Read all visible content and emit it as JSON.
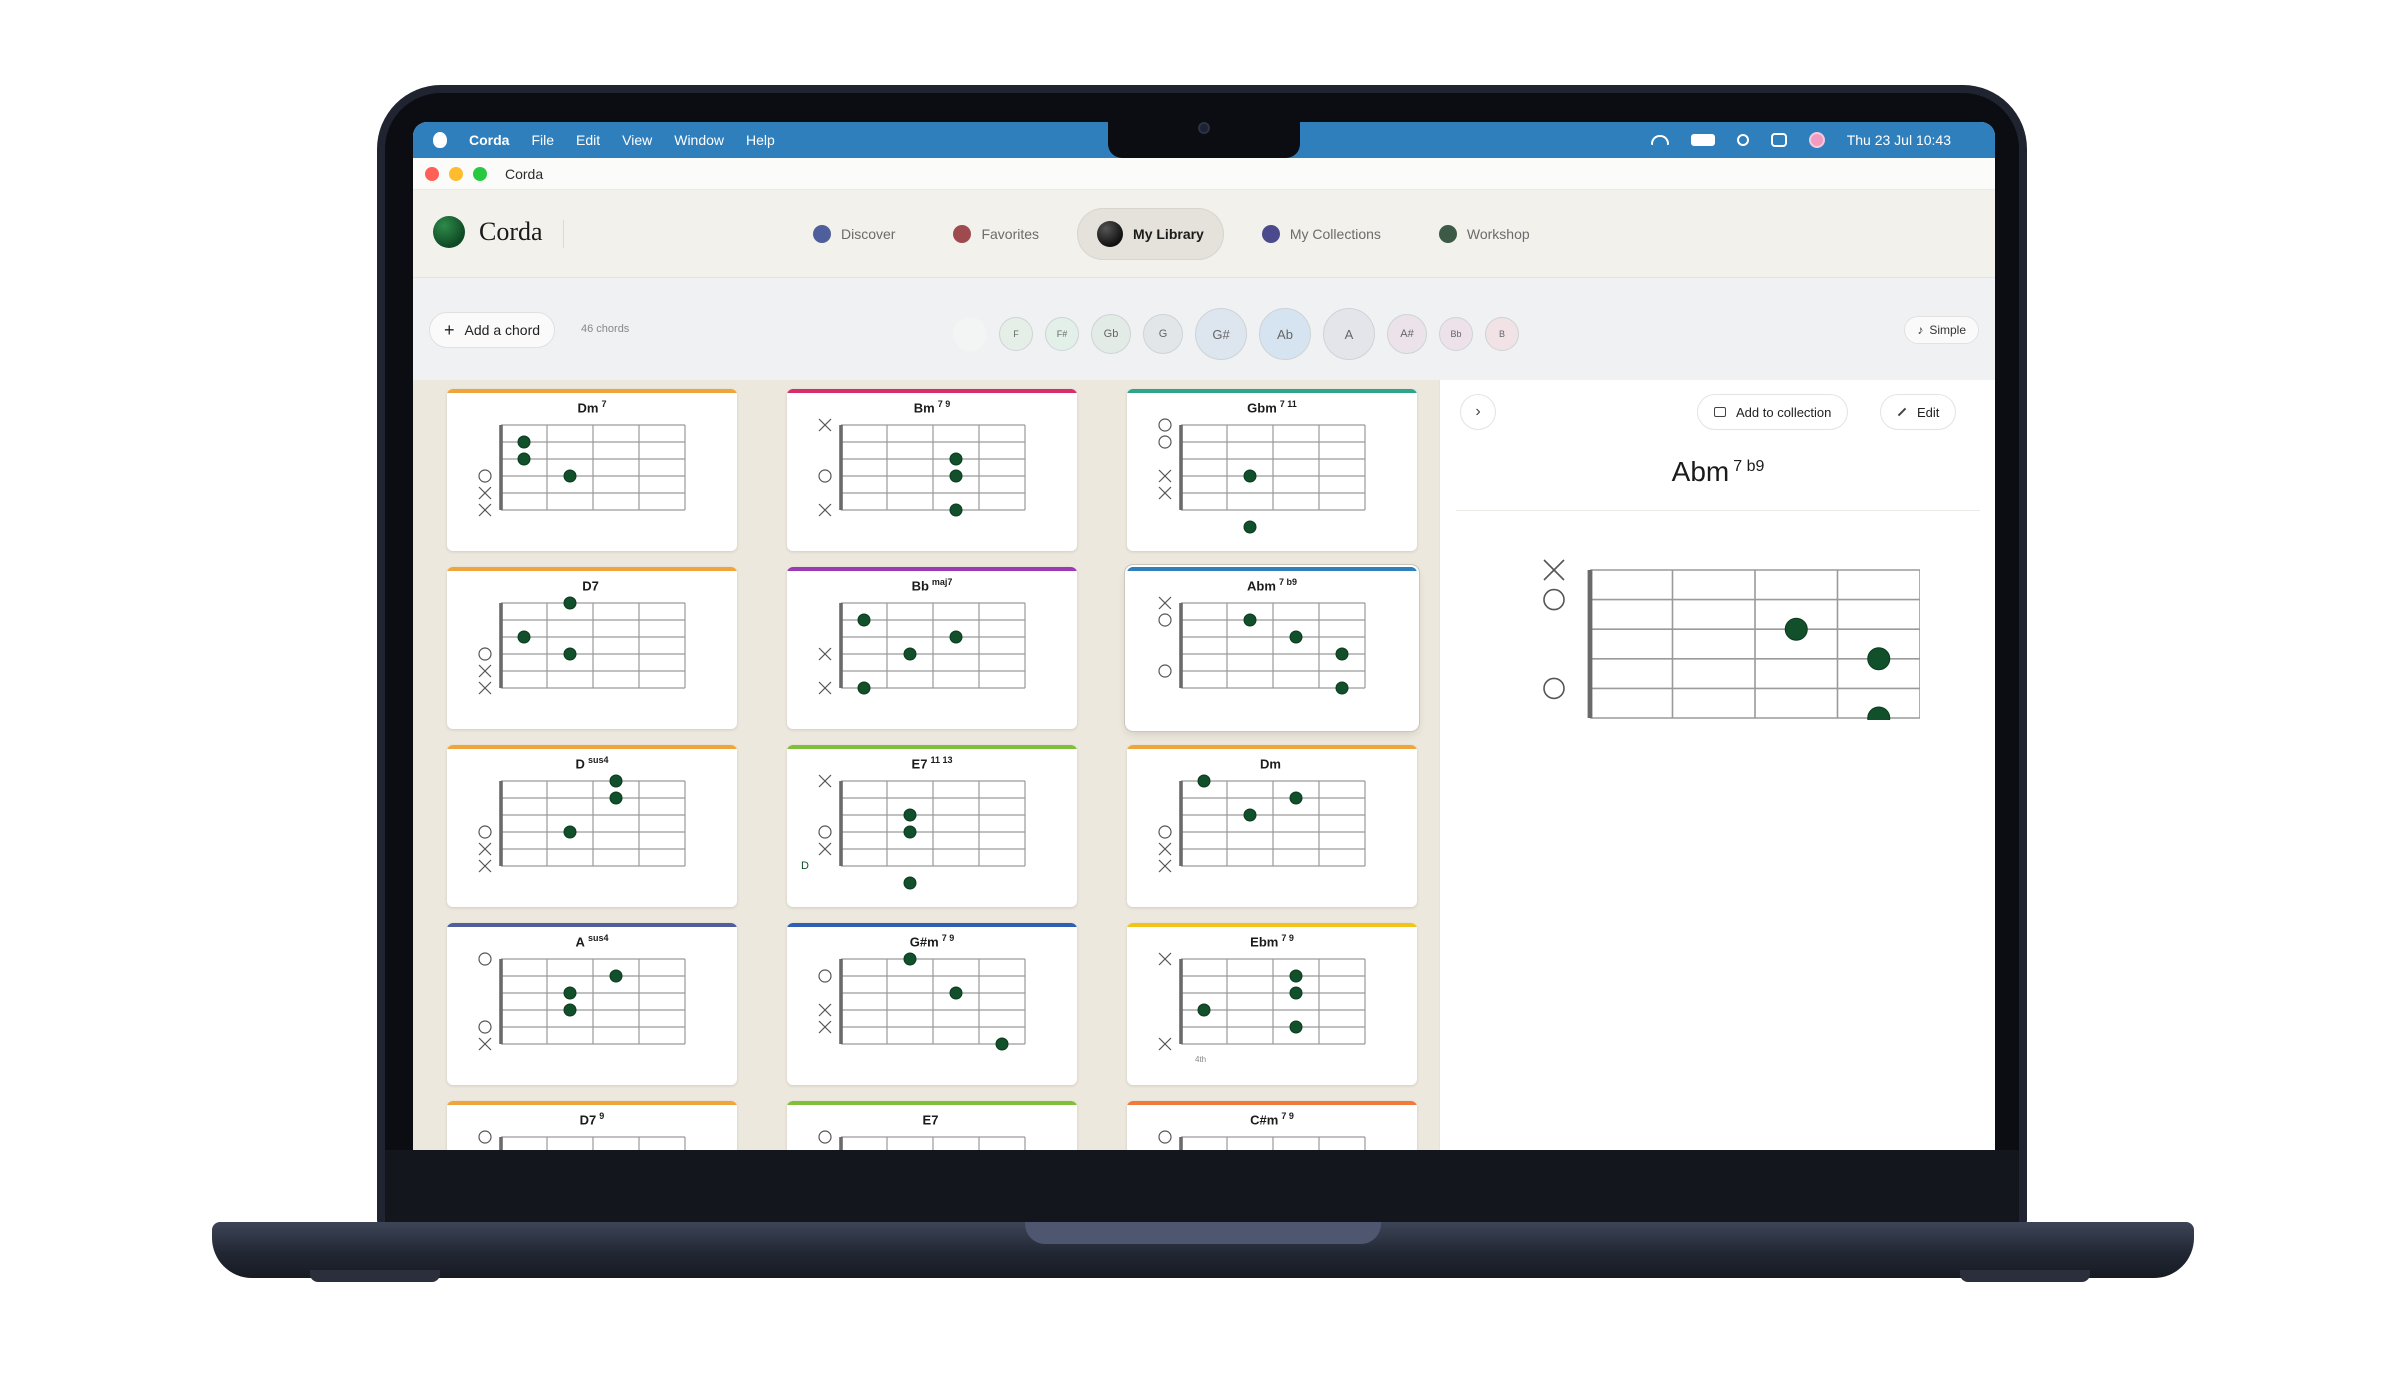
{
  "menubar": {
    "app_name": "Corda",
    "menus": [
      "File",
      "Edit",
      "View",
      "Window",
      "Help"
    ],
    "datetime": "Thu 23 Jul  10:43"
  },
  "window": {
    "title": "Corda"
  },
  "header": {
    "logo_text": "Corda",
    "nav": [
      {
        "label": "Discover",
        "color": "#4f5f9b"
      },
      {
        "label": "Favorites",
        "color": "#9e4a4f"
      },
      {
        "label": "My Library",
        "color": "#111111",
        "active": true
      },
      {
        "label": "My Collections",
        "color": "#4b4a8d"
      },
      {
        "label": "Workshop",
        "color": "#3c5a46"
      }
    ]
  },
  "toolbar": {
    "add_label": "Add a chord",
    "count_label": "46 chords",
    "notes": [
      {
        "label": "",
        "bg": "#f3f4f4",
        "size": "s"
      },
      {
        "label": "F",
        "bg": "#e5efe8",
        "size": "s"
      },
      {
        "label": "F#",
        "bg": "#e3efe9",
        "size": "s"
      },
      {
        "label": "Gb",
        "bg": "#e3ebe6",
        "size": "m"
      },
      {
        "label": "G",
        "bg": "#e2e6e9",
        "size": "m"
      },
      {
        "label": "G#",
        "bg": "#dde6ef",
        "size": "l"
      },
      {
        "label": "Ab",
        "bg": "#d6e3f0",
        "size": "l"
      },
      {
        "label": "A",
        "bg": "#e4e5ea",
        "size": "l"
      },
      {
        "label": "A#",
        "bg": "#ece2ea",
        "size": "m"
      },
      {
        "label": "Bb",
        "bg": "#eee2ea",
        "size": "s"
      },
      {
        "label": "B",
        "bg": "#f1e2e6",
        "size": "s"
      }
    ],
    "simple_label": "Simple"
  },
  "chords": [
    {
      "root": "Dm",
      "ext": "7",
      "stripe": "#f0a53a",
      "marks": [
        "",
        "",
        "",
        "O",
        "X",
        "X"
      ],
      "dots": [
        [
          1,
          0.5
        ],
        [
          2,
          0.5
        ],
        [
          3,
          1.5
        ]
      ],
      "fret_label": ""
    },
    {
      "root": "Bm",
      "ext": "7 9",
      "stripe": "#d62e6a",
      "marks": [
        "X",
        "",
        "",
        "O",
        "",
        "X"
      ],
      "dots": [
        [
          2,
          2.5
        ],
        [
          3,
          2.5
        ],
        [
          5,
          2.5
        ]
      ],
      "fret_label": ""
    },
    {
      "root": "Gbm",
      "ext": "7 11",
      "stripe": "#2ea58a",
      "marks": [
        "O",
        "O",
        "",
        "X",
        "X",
        ""
      ],
      "dots": [
        [
          3,
          1.5
        ],
        [
          6,
          1.5
        ]
      ],
      "fret_label": ""
    },
    {
      "root": "D7",
      "ext": "",
      "stripe": "#f0a53a",
      "marks": [
        "",
        "",
        "",
        "O",
        "X",
        "X"
      ],
      "dots": [
        [
          0,
          1.5
        ],
        [
          2,
          0.5
        ],
        [
          3,
          1.5
        ]
      ],
      "fret_label": ""
    },
    {
      "root": "Bb",
      "ext": "maj7",
      "stripe": "#9c3ab5",
      "marks": [
        "",
        "",
        "",
        "X",
        "",
        "X"
      ],
      "dots": [
        [
          1,
          0.5
        ],
        [
          2,
          2.5
        ],
        [
          3,
          1.5
        ],
        [
          5,
          0.5
        ]
      ],
      "fret_label": ""
    },
    {
      "root": "Abm",
      "ext": "7 b9",
      "stripe": "#2f7fbd",
      "marks": [
        "X",
        "O",
        "",
        "",
        "O",
        ""
      ],
      "dots": [
        [
          2,
          2.5
        ],
        [
          3,
          3.5
        ],
        [
          5,
          3.5
        ],
        [
          1,
          1.5
        ]
      ],
      "fret_label": "",
      "selected": true
    },
    {
      "root": "D",
      "ext": "sus4",
      "stripe": "#f0a53a",
      "marks": [
        "",
        "",
        "",
        "O",
        "X",
        "X"
      ],
      "dots": [
        [
          0,
          2.5
        ],
        [
          1,
          2.5
        ],
        [
          3,
          1.5
        ]
      ],
      "fret_label": ""
    },
    {
      "root": "E7",
      "ext": "11 13",
      "stripe": "#7fbf3a",
      "marks": [
        "X",
        "",
        "",
        "O",
        "X",
        ""
      ],
      "dots": [
        [
          2,
          1.5
        ],
        [
          3,
          1.5
        ],
        [
          6,
          1.5
        ]
      ],
      "fret_label": "D"
    },
    {
      "root": "Dm",
      "ext": "",
      "stripe": "#f0a53a",
      "marks": [
        "",
        "",
        "",
        "O",
        "X",
        "X"
      ],
      "dots": [
        [
          0,
          0.5
        ],
        [
          1,
          2.5
        ],
        [
          2,
          1.5
        ]
      ],
      "fret_label": ""
    },
    {
      "root": "A",
      "ext": "sus4",
      "stripe": "#4f5f9b",
      "marks": [
        "O",
        "",
        "",
        "",
        "O",
        "X"
      ],
      "dots": [
        [
          1,
          2.5
        ],
        [
          2,
          1.5
        ],
        [
          3,
          1.5
        ]
      ],
      "fret_label": ""
    },
    {
      "root": "G#m",
      "ext": "7 9",
      "stripe": "#2f5fb5",
      "marks": [
        "",
        "O",
        "",
        "X",
        "X",
        ""
      ],
      "dots": [
        [
          0,
          1.5
        ],
        [
          2,
          2.5
        ],
        [
          5,
          3.5
        ]
      ],
      "fret_label": ""
    },
    {
      "root": "Ebm",
      "ext": "7 9",
      "stripe": "#f2c318",
      "marks": [
        "X",
        "",
        "",
        "",
        "",
        "X"
      ],
      "dots": [
        [
          1,
          2.5
        ],
        [
          2,
          2.5
        ],
        [
          3,
          0.5
        ],
        [
          4,
          2.5
        ]
      ],
      "fret_label": "4th"
    },
    {
      "root": "D7",
      "ext": "9",
      "stripe": "#f0a53a",
      "marks": [
        "O",
        "",
        "",
        "",
        "",
        ""
      ],
      "dots": [],
      "fret_label": ""
    },
    {
      "root": "E7",
      "ext": "",
      "stripe": "#7fbf3a",
      "marks": [
        "O",
        "",
        "",
        "",
        "",
        ""
      ],
      "dots": [],
      "fret_label": ""
    },
    {
      "root": "C#m",
      "ext": "7 9",
      "stripe": "#f07a3a",
      "marks": [
        "O",
        "",
        "",
        "",
        "",
        ""
      ],
      "dots": [],
      "fret_label": ""
    }
  ],
  "detail": {
    "add_collection_label": "Add to collection",
    "edit_label": "Edit",
    "chord_root": "Abm",
    "chord_ext": "7 b9",
    "marks": [
      "X",
      "O",
      "",
      "",
      "O",
      ""
    ],
    "dots": [
      [
        2,
        2.5
      ],
      [
        3,
        3.5
      ],
      [
        5,
        3.5
      ]
    ]
  },
  "colors": {
    "dot_fill": "#11502b",
    "menubar": "#2f7fbd"
  }
}
